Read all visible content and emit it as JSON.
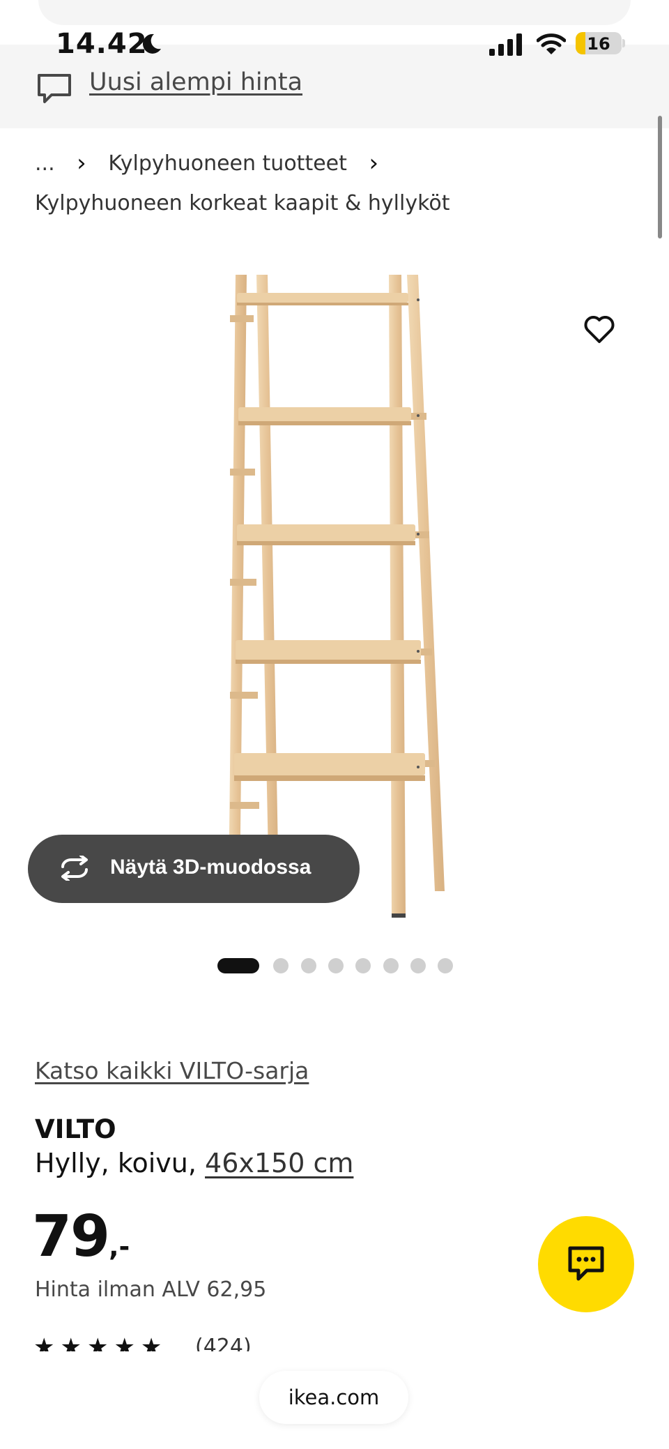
{
  "status_bar": {
    "time": "14.42",
    "battery": "16"
  },
  "banner": {
    "link_text": "Uusi alempi hinta"
  },
  "breadcrumb": {
    "ellipsis": "...",
    "level1": "Kylpyhuoneen tuotteet",
    "level2": "Kylpyhuoneen korkeat kaapit & hyllyköt"
  },
  "gallery": {
    "view_3d_label": "Näytä 3D-muodossa",
    "image_count": 8,
    "active_index": 0
  },
  "product": {
    "series_link": "Katso kaikki VILTO-sarja",
    "name": "VILTO",
    "description": "Hylly, koivu,",
    "dimensions": "46x150 cm",
    "price_integer": "79",
    "price_suffix": ",-",
    "price_excl_vat": "Hinta ilman ALV 62,95",
    "rating_stars": 5,
    "rating_count": "(424)"
  },
  "browser": {
    "domain": "ikea.com"
  },
  "colors": {
    "accent_yellow": "#ffdb00",
    "button_dark": "#484848",
    "wood": "#e8c9a0"
  },
  "icons": {
    "banner": "speech-bubble-icon",
    "favorite": "heart-icon",
    "view_3d": "rotate-icon",
    "chat": "chat-icon"
  }
}
